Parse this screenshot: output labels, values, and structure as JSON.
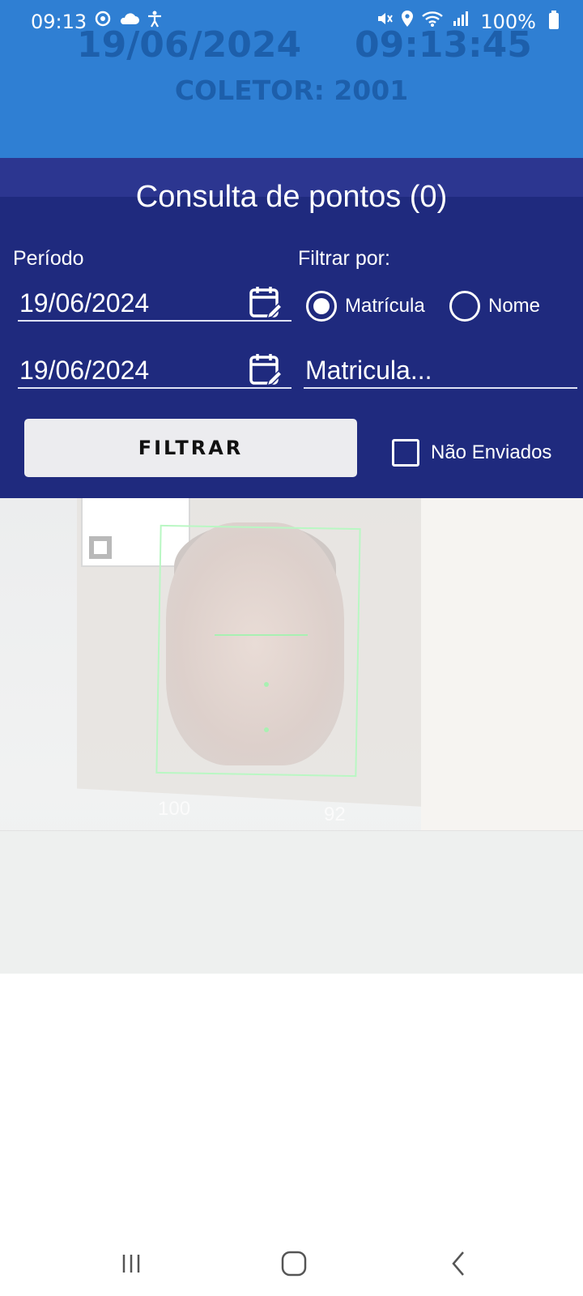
{
  "status_bar": {
    "time": "09:13",
    "battery": "100%",
    "left_icons": [
      "sync-icon",
      "cloud-icon",
      "accessibility-icon"
    ],
    "right_icons": [
      "mute-icon",
      "location-icon",
      "wifi-icon",
      "signal-icon"
    ]
  },
  "header": {
    "date": "19/06/2024",
    "time": "09:13:45",
    "collector": "COLETOR: 2001"
  },
  "dialog": {
    "title": "Consulta de pontos (0)",
    "period_label": "Período",
    "filter_by_label": "Filtrar por:",
    "start_date": "19/06/2024",
    "end_date": "19/06/2024",
    "radio_matricula": "Matrícula",
    "radio_nome": "Nome",
    "selected_filter": "Matrícula",
    "matricula_placeholder": "Matricula...",
    "filter_button": "FILTRAR",
    "not_sent_label": "Não Enviados",
    "not_sent_checked": false
  },
  "camera": {
    "score_left": "100",
    "score_right": "92"
  },
  "colors": {
    "header_bg": "#2f7fd3",
    "dialog_bg": "#1f2a7e",
    "button_bg": "#ececef",
    "detection_box": "#b9f7c3"
  }
}
